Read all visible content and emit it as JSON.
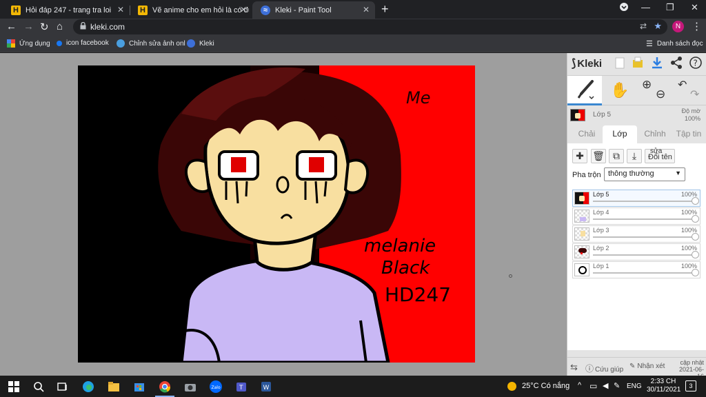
{
  "browser": {
    "tabs": [
      {
        "title": "Hỏi đáp 247 - trang tra loi"
      },
      {
        "title": "Vẽ anime cho em hỏi là có được"
      },
      {
        "title": "Kleki - Paint Tool"
      }
    ],
    "url": "kleki.com",
    "profile_initial": "N",
    "bookmarks": [
      "Ứng dụng",
      "icon facebook",
      "Chỉnh sửa ảnh onl",
      "Kleki"
    ],
    "reading_list": "Danh sách đọc"
  },
  "kleki": {
    "logo": "Kleki",
    "current_layer": {
      "name": "Lớp 5",
      "opacity_label": "Độ mờ",
      "opacity": "100%"
    },
    "tabs": [
      "Chải",
      "Lớp",
      "Chỉnh",
      "Tập tin"
    ],
    "active_tab": "Lớp",
    "rename_label_top": "sửa",
    "rename_label": "Đổi tên",
    "blend_label": "Pha trộn",
    "blend_value": "thông thường",
    "layers": [
      {
        "name": "Lớp 5",
        "opacity": "100%",
        "opacity_value": 1.0,
        "selected": true
      },
      {
        "name": "Lớp 4",
        "opacity": "100%",
        "opacity_value": 1.0,
        "selected": false
      },
      {
        "name": "Lớp 3",
        "opacity": "100%",
        "opacity_value": 1.0,
        "selected": false
      },
      {
        "name": "Lớp 2",
        "opacity": "100%",
        "opacity_value": 1.0,
        "selected": false
      },
      {
        "name": "Lớp 1",
        "opacity": "100%",
        "opacity_value": 1.0,
        "selected": false
      }
    ],
    "bottom": {
      "help": "Cứu giúp",
      "feedback": "Nhận xét",
      "update_label": "cập nhật",
      "update_date": "2021-06-16"
    }
  },
  "artwork_text": {
    "me": "Me",
    "line1": "melanie",
    "line2": "Black",
    "line3": "HD247"
  },
  "taskbar": {
    "weather_temp": "25°C",
    "weather_text": "Có nắng",
    "language": "ENG",
    "time": "2:33 CH",
    "date": "30/11/2021",
    "notifications": "3"
  }
}
